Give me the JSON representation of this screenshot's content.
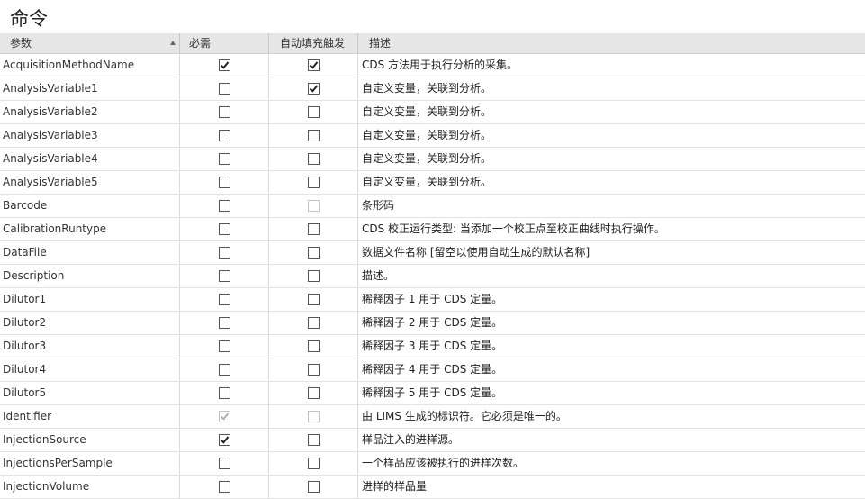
{
  "title": "命令",
  "columns": {
    "param": "参数",
    "required": "必需",
    "autofill": "自动填充触发",
    "description": "描述"
  },
  "rows": [
    {
      "name": "AcquisitionMethodName",
      "required": true,
      "required_disabled": false,
      "autofill": true,
      "autofill_disabled": false,
      "description": "CDS 方法用于执行分析的采集。"
    },
    {
      "name": "AnalysisVariable1",
      "required": false,
      "required_disabled": false,
      "autofill": true,
      "autofill_disabled": false,
      "description": "自定义变量，关联到分析。"
    },
    {
      "name": "AnalysisVariable2",
      "required": false,
      "required_disabled": false,
      "autofill": false,
      "autofill_disabled": false,
      "description": "自定义变量，关联到分析。"
    },
    {
      "name": "AnalysisVariable3",
      "required": false,
      "required_disabled": false,
      "autofill": false,
      "autofill_disabled": false,
      "description": "自定义变量，关联到分析。"
    },
    {
      "name": "AnalysisVariable4",
      "required": false,
      "required_disabled": false,
      "autofill": false,
      "autofill_disabled": false,
      "description": "自定义变量，关联到分析。"
    },
    {
      "name": "AnalysisVariable5",
      "required": false,
      "required_disabled": false,
      "autofill": false,
      "autofill_disabled": false,
      "description": "自定义变量，关联到分析。"
    },
    {
      "name": "Barcode",
      "required": false,
      "required_disabled": false,
      "autofill": false,
      "autofill_disabled": true,
      "description": "条形码"
    },
    {
      "name": "CalibrationRuntype",
      "required": false,
      "required_disabled": false,
      "autofill": false,
      "autofill_disabled": false,
      "description": "CDS 校正运行类型: 当添加一个校正点至校正曲线时执行操作。"
    },
    {
      "name": "DataFile",
      "required": false,
      "required_disabled": false,
      "autofill": false,
      "autofill_disabled": false,
      "description": "数据文件名称 [留空以使用自动生成的默认名称]"
    },
    {
      "name": "Description",
      "required": false,
      "required_disabled": false,
      "autofill": false,
      "autofill_disabled": false,
      "description": "描述。"
    },
    {
      "name": "Dilutor1",
      "required": false,
      "required_disabled": false,
      "autofill": false,
      "autofill_disabled": false,
      "description": "稀释因子 1 用于 CDS 定量。"
    },
    {
      "name": "Dilutor2",
      "required": false,
      "required_disabled": false,
      "autofill": false,
      "autofill_disabled": false,
      "description": "稀释因子 2 用于 CDS 定量。"
    },
    {
      "name": "Dilutor3",
      "required": false,
      "required_disabled": false,
      "autofill": false,
      "autofill_disabled": false,
      "description": "稀释因子 3 用于 CDS 定量。"
    },
    {
      "name": "Dilutor4",
      "required": false,
      "required_disabled": false,
      "autofill": false,
      "autofill_disabled": false,
      "description": "稀释因子 4 用于 CDS 定量。"
    },
    {
      "name": "Dilutor5",
      "required": false,
      "required_disabled": false,
      "autofill": false,
      "autofill_disabled": false,
      "description": "稀释因子 5 用于 CDS 定量。"
    },
    {
      "name": "Identifier",
      "required": true,
      "required_disabled": true,
      "autofill": false,
      "autofill_disabled": true,
      "description": "由 LIMS 生成的标识符。它必须是唯一的。"
    },
    {
      "name": "InjectionSource",
      "required": true,
      "required_disabled": false,
      "autofill": false,
      "autofill_disabled": false,
      "description": "样品注入的进样源。"
    },
    {
      "name": "InjectionsPerSample",
      "required": false,
      "required_disabled": false,
      "autofill": false,
      "autofill_disabled": false,
      "description": "一个样品应该被执行的进样次数。"
    },
    {
      "name": "InjectionVolume",
      "required": false,
      "required_disabled": false,
      "autofill": false,
      "autofill_disabled": false,
      "description": "进样的样品量"
    }
  ]
}
